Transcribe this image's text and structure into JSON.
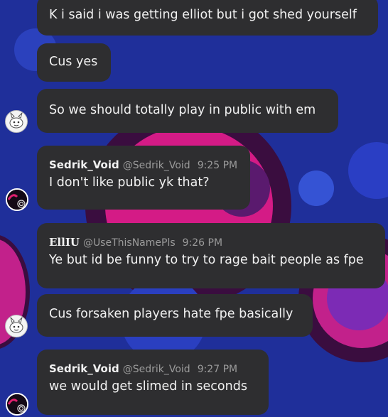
{
  "messages": [
    {
      "text": "K i said i was getting elliot but i got shed yourself"
    },
    {
      "text": "Cus yes"
    },
    {
      "text": "So we should totally play in public with em"
    },
    {
      "name": "Sedrik_Void",
      "handle": "@Sedrik_Void",
      "time": "9:25 PM",
      "text": "I don't like public yk that?"
    },
    {
      "name": "EllIU",
      "handle": "@UseThisNamePls",
      "time": "9:26 PM",
      "text": "Ye but id be funny to try to rage bait people as fpe"
    },
    {
      "text": "Cus forsaken players hate fpe basically"
    },
    {
      "name": "Sedrik_Void",
      "handle": "@Sedrik_Void",
      "time": "9:27 PM",
      "text": "we would get slimed in seconds"
    }
  ],
  "avatars": [
    {
      "icon": "white-creature-avatar-icon"
    },
    {
      "icon": "dark-spiral-avatar-icon"
    },
    {
      "icon": "white-creature-avatar-icon"
    },
    {
      "icon": "dark-spiral-avatar-icon"
    }
  ],
  "colors": {
    "background": "#1f2f9a",
    "bubble": "#2e2e30",
    "accent_pink": "#d41b86"
  }
}
